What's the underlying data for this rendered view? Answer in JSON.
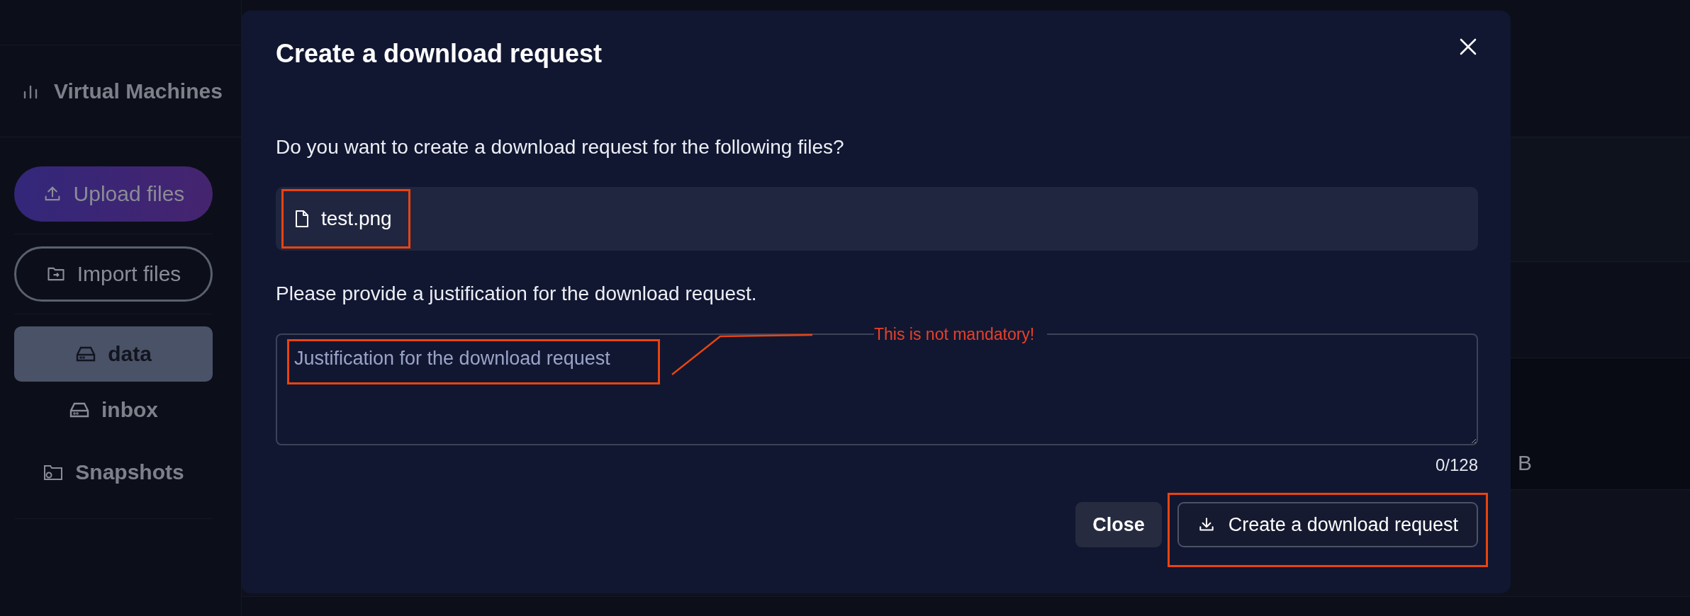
{
  "sidebar": {
    "header": {
      "label": "Virtual Machines"
    },
    "buttons": [
      {
        "label": "Upload files",
        "kind": "primary"
      },
      {
        "label": "Import files",
        "kind": "outline"
      }
    ],
    "items": [
      {
        "label": "data",
        "kind": "drive",
        "selected": true
      },
      {
        "label": "inbox",
        "kind": "drive",
        "selected": false
      },
      {
        "label": "Snapshots",
        "kind": "snapshot",
        "selected": false
      }
    ]
  },
  "background": {
    "fragment": "B"
  },
  "dialog": {
    "title": "Create a download request",
    "question": "Do you want to create a download request for the following files?",
    "files": [
      {
        "name": "test.png",
        "highlighted": true
      }
    ],
    "justification_label": "Please provide a justification for the download request.",
    "justification_field": {
      "placeholder": "Justification for the download request",
      "counter": "0/128",
      "highlighted": true,
      "note": "This is not mandatory!"
    },
    "buttons": [
      {
        "label": "Close",
        "kind": "secondary",
        "highlighted": false
      },
      {
        "label": "Create a download request",
        "kind": "primary",
        "highlighted": true
      }
    ]
  }
}
